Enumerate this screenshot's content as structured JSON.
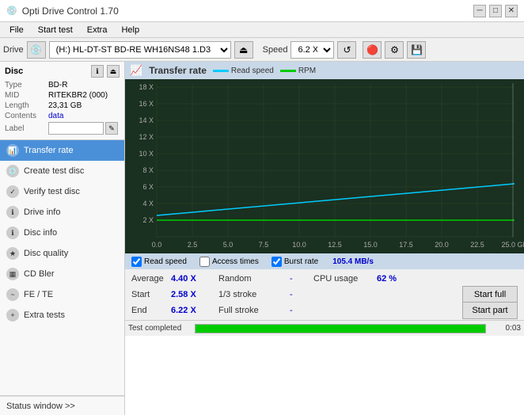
{
  "app": {
    "title": "Opti Drive Control 1.70",
    "icon": "💿"
  },
  "titlebar": {
    "minimize": "─",
    "maximize": "□",
    "close": "✕"
  },
  "menu": {
    "items": [
      "File",
      "Start test",
      "Extra",
      "Help"
    ]
  },
  "toolbar": {
    "drive_label": "Drive",
    "drive_value": "(H:) HL-DT-ST BD-RE  WH16NS48 1.D3",
    "speed_label": "Speed",
    "speed_value": "6.2 X"
  },
  "disc": {
    "header": "Disc",
    "type_label": "Type",
    "type_value": "BD-R",
    "mid_label": "MID",
    "mid_value": "RITEKBR2 (000)",
    "length_label": "Length",
    "length_value": "23,31 GB",
    "contents_label": "Contents",
    "contents_value": "data",
    "label_label": "Label",
    "label_value": ""
  },
  "nav": {
    "items": [
      {
        "id": "transfer-rate",
        "label": "Transfer rate",
        "active": true
      },
      {
        "id": "create-test-disc",
        "label": "Create test disc",
        "active": false
      },
      {
        "id": "verify-test-disc",
        "label": "Verify test disc",
        "active": false
      },
      {
        "id": "drive-info",
        "label": "Drive info",
        "active": false
      },
      {
        "id": "disc-info",
        "label": "Disc info",
        "active": false
      },
      {
        "id": "disc-quality",
        "label": "Disc quality",
        "active": false
      },
      {
        "id": "cd-bler",
        "label": "CD Bler",
        "active": false
      },
      {
        "id": "fe-te",
        "label": "FE / TE",
        "active": false
      },
      {
        "id": "extra-tests",
        "label": "Extra tests",
        "active": false
      }
    ],
    "status_window": "Status window >>"
  },
  "chart": {
    "title": "Transfer rate",
    "legend": {
      "read_speed_label": "Read speed",
      "rpm_label": "RPM"
    },
    "y_labels": [
      "18 X",
      "16 X",
      "14 X",
      "12 X",
      "10 X",
      "8 X",
      "6 X",
      "4 X",
      "2 X"
    ],
    "x_labels": [
      "0.0",
      "2.5",
      "5.0",
      "7.5",
      "10.0",
      "12.5",
      "15.0",
      "17.5",
      "20.0",
      "22.5",
      "25.0 GB"
    ]
  },
  "checkboxes": {
    "read_speed_label": "Read speed",
    "read_speed_checked": true,
    "access_times_label": "Access times",
    "access_times_checked": false,
    "burst_rate_label": "Burst rate",
    "burst_rate_checked": true,
    "burst_rate_value": "105.4 MB/s"
  },
  "stats": {
    "average_label": "Average",
    "average_value": "4.40 X",
    "random_label": "Random",
    "random_value": "-",
    "cpu_label": "CPU usage",
    "cpu_value": "62 %",
    "start_label": "Start",
    "start_value": "2.58 X",
    "stroke13_label": "1/3 stroke",
    "stroke13_value": "-",
    "start_full_label": "Start full",
    "end_label": "End",
    "end_value": "6.22 X",
    "full_stroke_label": "Full stroke",
    "full_stroke_value": "-",
    "start_part_label": "Start part"
  },
  "statusbar": {
    "text": "Test completed",
    "progress": 100,
    "time": "0:03"
  }
}
